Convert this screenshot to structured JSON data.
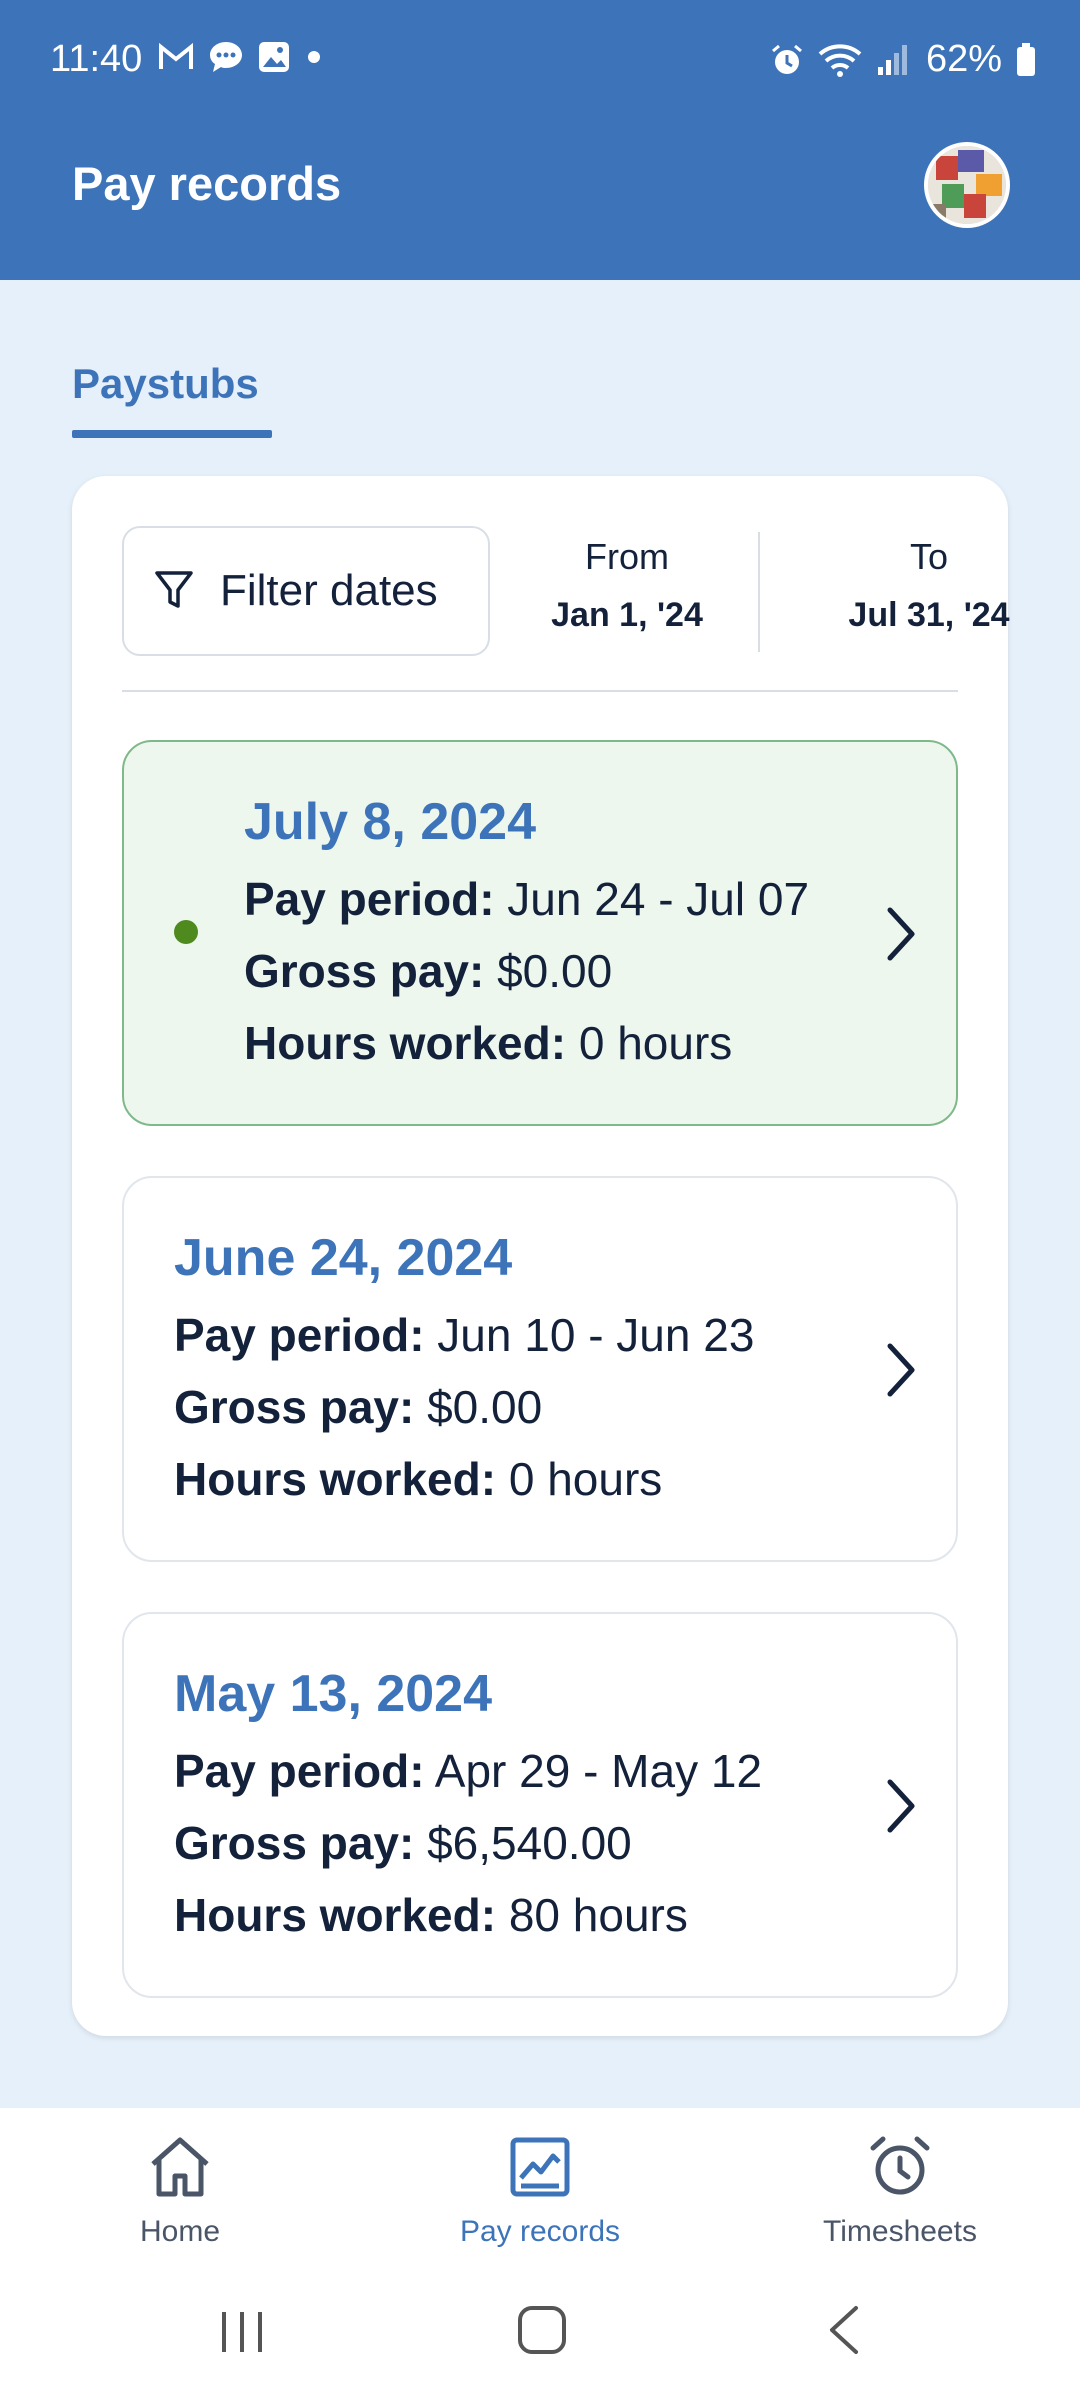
{
  "status_bar": {
    "time": "11:40",
    "battery": "62%",
    "icons": [
      "gmail-icon",
      "chat-icon",
      "gallery-icon",
      "dot-icon",
      "alarm-icon",
      "wifi-icon",
      "signal-icon",
      "battery-icon"
    ]
  },
  "header": {
    "title": "Pay records"
  },
  "tabs": [
    {
      "label": "Paystubs",
      "active": true
    }
  ],
  "filter": {
    "button_label": "Filter dates",
    "from_label": "From",
    "from_value": "Jan 1, '24",
    "to_label": "To",
    "to_value": "Jul 31, '24"
  },
  "labels": {
    "pay_period": "Pay period:",
    "gross_pay": "Gross pay:",
    "hours_worked": "Hours worked:"
  },
  "paystubs": [
    {
      "date": "July 8, 2024",
      "period": "Jun 24 - Jul 07",
      "gross": "$0.00",
      "hours": "0 hours",
      "current": true
    },
    {
      "date": "June 24, 2024",
      "period": "Jun 10 - Jun 23",
      "gross": "$0.00",
      "hours": "0 hours",
      "current": false
    },
    {
      "date": "May 13, 2024",
      "period": "Apr 29 - May 12",
      "gross": "$6,540.00",
      "hours": "80 hours",
      "current": false
    }
  ],
  "bottom_nav": [
    {
      "label": "Home",
      "icon": "home-icon",
      "active": false
    },
    {
      "label": "Pay records",
      "icon": "chart-icon",
      "active": true
    },
    {
      "label": "Timesheets",
      "icon": "alarm-clock-icon",
      "active": false
    }
  ],
  "colors": {
    "primary": "#3d74b9",
    "active_stub_bg": "#edf7ee",
    "active_dot": "#4f8a1f"
  }
}
